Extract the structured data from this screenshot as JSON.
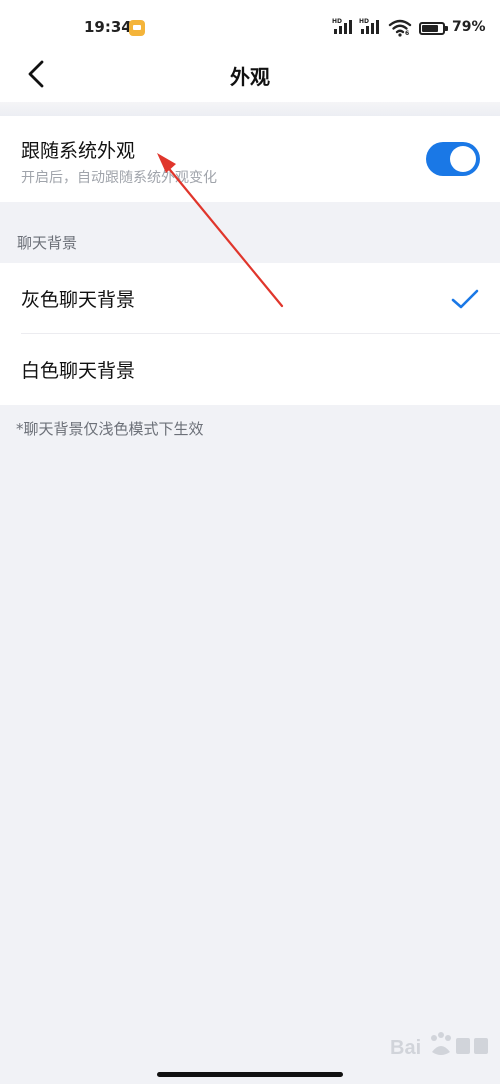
{
  "status_bar": {
    "time": "19:34",
    "signal_1_label": "HD",
    "signal_2_label": "HD",
    "wifi_sub": "6",
    "battery": "79%"
  },
  "nav": {
    "title": "外观"
  },
  "follow_system": {
    "title": "跟随系统外观",
    "description": "开启后，自动跟随系统外观变化",
    "enabled": true
  },
  "chat_background": {
    "section_label": "聊天背景",
    "options": [
      {
        "label": "灰色聊天背景",
        "selected": true
      },
      {
        "label": "白色聊天背景",
        "selected": false
      }
    ],
    "note": "*聊天背景仅浅色模式下生效"
  },
  "colors": {
    "accent": "#1a78e6",
    "annotation_arrow": "#e0362c",
    "background": "#f1f2f6"
  }
}
